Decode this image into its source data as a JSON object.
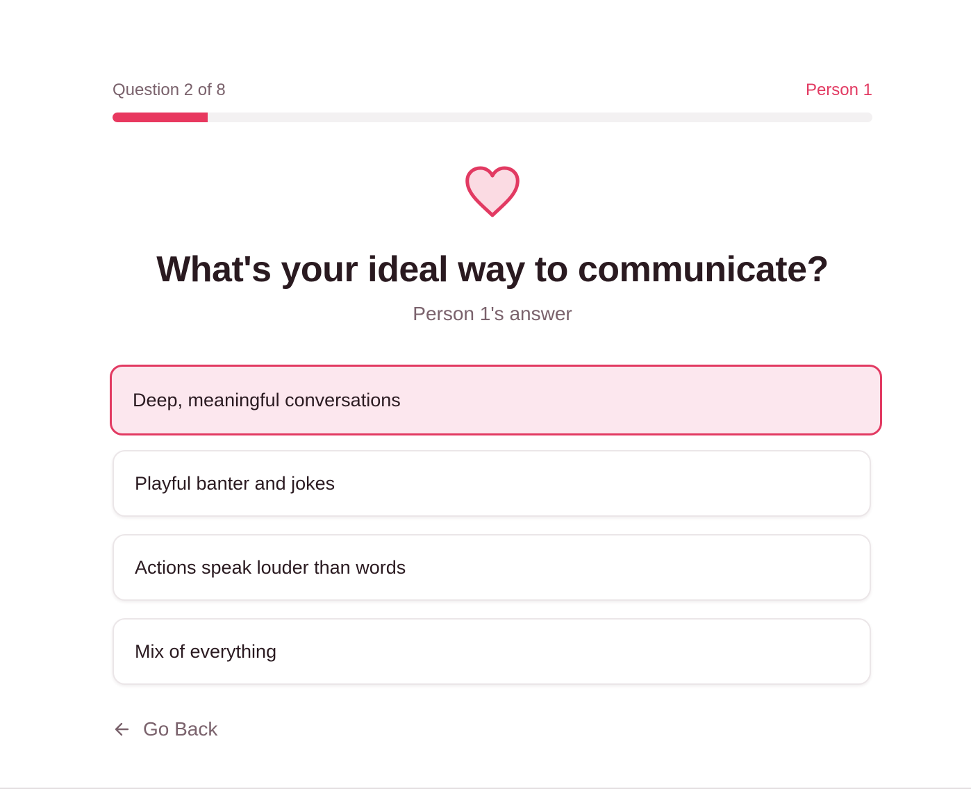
{
  "progress": {
    "counter_label": "Question 2 of 8",
    "person_label": "Person 1",
    "fill_fraction": 0.125,
    "accent_color": "#e8385f"
  },
  "question": {
    "icon": "heart-icon",
    "title": "What's your ideal way to communicate?",
    "subtitle": "Person 1's answer"
  },
  "options": [
    {
      "label": "Deep, meaningful conversations",
      "selected": true
    },
    {
      "label": "Playful banter and jokes",
      "selected": false
    },
    {
      "label": "Actions speak louder than words",
      "selected": false
    },
    {
      "label": "Mix of everything",
      "selected": false
    }
  ],
  "navigation": {
    "back_icon": "arrow-left-icon",
    "back_label": "Go Back"
  }
}
